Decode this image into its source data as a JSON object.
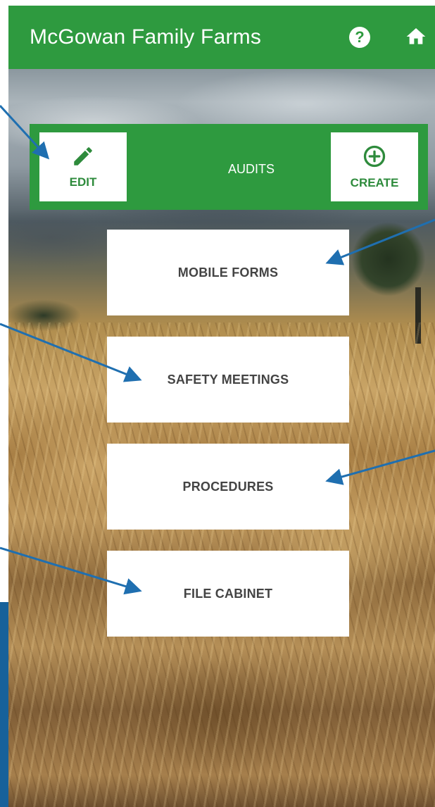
{
  "app": {
    "title": "McGowan Family Farms",
    "brand_color": "#2e9a3f",
    "icons": {
      "help": "help-circle-icon",
      "home": "home-icon"
    }
  },
  "audits": {
    "label": "AUDITS",
    "edit_label": "EDIT",
    "create_label": "CREATE",
    "icons": {
      "edit": "pencil-icon",
      "create": "plus-circle-icon"
    }
  },
  "menu": {
    "mobile_forms": "MOBILE FORMS",
    "safety_meetings": "SAFETY MEETINGS",
    "procedures": "PROCEDURES",
    "file_cabinet": "FILE CABINET"
  },
  "annotation_color": "#1f6fb0"
}
